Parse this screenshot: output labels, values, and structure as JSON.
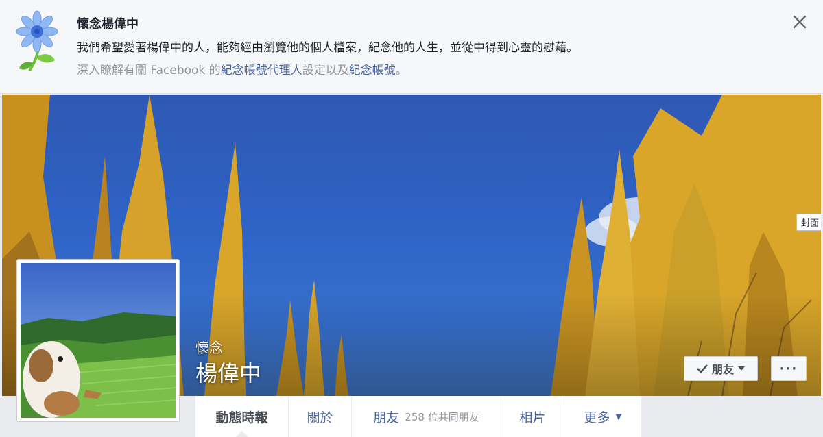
{
  "banner": {
    "title": "懷念楊偉中",
    "text": "我們希望愛著楊偉中的人，能夠經由瀏覽他的個人檔案，紀念他的人生，並從中得到心靈的慰藉。",
    "links_prefix": "深入瞭解有關 Facebook 的",
    "link_legacy_contact": "紀念帳號代理人",
    "links_middle": "設定以及",
    "link_memorialized": "紀念帳號",
    "links_suffix": "。",
    "close_icon": "close-icon",
    "flower_icon": "forget-me-not-flower-icon"
  },
  "cover": {
    "tooltip": "封面",
    "memorial_label": "懷念",
    "name": "楊偉中"
  },
  "actions": {
    "friend_label": "朋友",
    "friend_check_icon": "check-icon",
    "friend_caret_icon": "caret-down-icon",
    "more_label": "···"
  },
  "tabs": {
    "timeline": "動態時報",
    "about": "關於",
    "friends": "朋友",
    "friends_sub": "258 位共同朋友",
    "photos": "相片",
    "more": "更多",
    "more_caret": "▼"
  },
  "colors": {
    "link": "#4b67a1",
    "sky": "#2e62c4",
    "foliage": "#d9a62a"
  }
}
